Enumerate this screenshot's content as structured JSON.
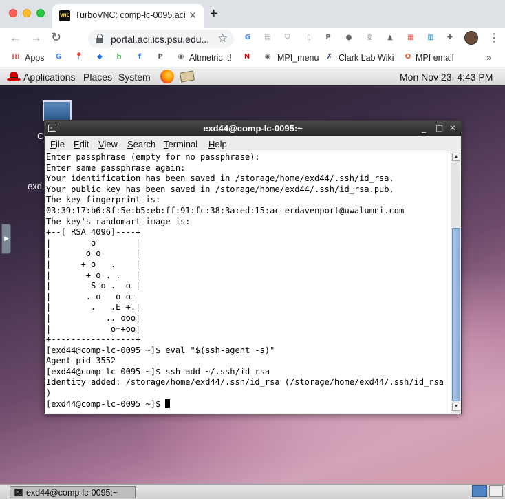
{
  "browser": {
    "tab_title": "TurboVNC: comp-lc-0095.aci",
    "tab_favicon_text": "VNC",
    "new_tab_symbol": "+",
    "close_symbol": "✕",
    "url": "portal.aci.ics.psu.edu...",
    "nav": {
      "back": "←",
      "forward": "→",
      "reload": "↻",
      "star": "☆",
      "menu": "⋮"
    },
    "extensions": [
      {
        "name": "translate-icon",
        "glyph": "G",
        "color": "#4285f4"
      },
      {
        "name": "reader-icon",
        "glyph": "▤",
        "color": "#9aa0a6"
      },
      {
        "name": "shield-icon",
        "glyph": "⛉",
        "color": "#9aa0a6"
      },
      {
        "name": "document-icon",
        "glyph": "▯",
        "color": "#9aa0a6"
      },
      {
        "name": "p-icon",
        "glyph": "P",
        "color": "#5f6368"
      },
      {
        "name": "circle-icon",
        "glyph": "●",
        "color": "#5f6368"
      },
      {
        "name": "chrome-icon",
        "glyph": "◎",
        "color": "#5f6368"
      },
      {
        "name": "drive-icon",
        "glyph": "▲",
        "color": "#5f6368"
      },
      {
        "name": "grid-icon",
        "glyph": "▦",
        "color": "#e8453c"
      },
      {
        "name": "trello-icon",
        "glyph": "▥",
        "color": "#0079bf"
      },
      {
        "name": "puzzle-icon",
        "glyph": "✚",
        "color": "#5f6368"
      }
    ]
  },
  "bookmarks": {
    "items": [
      {
        "label": "Apps",
        "icon": "apps-grid-icon",
        "glyph": "⁞⁞⁞",
        "color": "#e8453c"
      },
      {
        "label": "",
        "icon": "google-icon",
        "glyph": "G",
        "color": "#4285f4"
      },
      {
        "label": "",
        "icon": "maps-icon",
        "glyph": "📍",
        "color": "#34a853"
      },
      {
        "label": "",
        "icon": "diamond-icon",
        "glyph": "◆",
        "color": "#1a73e8"
      },
      {
        "label": "",
        "icon": "h-icon",
        "glyph": "h",
        "color": "#4caf50"
      },
      {
        "label": "",
        "icon": "facebook-icon",
        "glyph": "f",
        "color": "#1877f2"
      },
      {
        "label": "",
        "icon": "p-bookmark-icon",
        "glyph": "P",
        "color": "#5f6368"
      },
      {
        "label": "Altmetric it!",
        "icon": "globe-icon",
        "glyph": "◉",
        "color": "#5f6368"
      },
      {
        "label": "",
        "icon": "netflix-icon",
        "glyph": "N",
        "color": "#e50914"
      },
      {
        "label": "MPI_menu",
        "icon": "globe-icon",
        "glyph": "◉",
        "color": "#5f6368"
      },
      {
        "label": "Clark Lab Wiki",
        "icon": "wiki-icon",
        "glyph": "✗",
        "color": "#1b2f6e"
      },
      {
        "label": "MPI email",
        "icon": "mail-icon",
        "glyph": "O",
        "color": "#d65b2a"
      }
    ],
    "more": "»"
  },
  "gnome_panel": {
    "menus": [
      "Applications",
      "Places",
      "System"
    ],
    "clock": "Mon Nov 23,  4:43 PM"
  },
  "desktop": {
    "icon_label_partial": "C",
    "home_label_partial": "exd"
  },
  "terminal": {
    "title": "exd44@comp-lc-0095:~",
    "wm_buttons": [
      "_",
      "□",
      "✕"
    ],
    "menus": [
      {
        "first": "F",
        "rest": "ile"
      },
      {
        "first": "E",
        "rest": "dit"
      },
      {
        "first": "V",
        "rest": "iew"
      },
      {
        "first": "S",
        "rest": "earch"
      },
      {
        "first": "T",
        "rest": "erminal"
      },
      {
        "first": "H",
        "rest": "elp"
      }
    ],
    "lines": [
      "Enter passphrase (empty for no passphrase):",
      "Enter same passphrase again:",
      "Your identification has been saved in /storage/home/exd44/.ssh/id_rsa.",
      "Your public key has been saved in /storage/home/exd44/.ssh/id_rsa.pub.",
      "The key fingerprint is:",
      "03:39:17:b6:8f:5e:b5:eb:ff:91:fc:38:3a:ed:15:ac erdavenport@uwalumni.com",
      "The key's randomart image is:",
      "+--[ RSA 4096]----+",
      "|        o        |",
      "|       o o       |",
      "|      + o   .    |",
      "|       + o . .   |",
      "|        S o .  o |",
      "|       . o   o o|",
      "|        .   .E +.|",
      "|           .. ooo|",
      "|            o=+oo|",
      "+-----------------+",
      "[exd44@comp-lc-0095 ~]$ eval \"$(ssh-agent -s)\"",
      "Agent pid 3552",
      "[exd44@comp-lc-0095 ~]$ ssh-add ~/.ssh/id_rsa",
      "Identity added: /storage/home/exd44/.ssh/id_rsa (/storage/home/exd44/.ssh/id_rsa",
      ")"
    ],
    "prompt": "[exd44@comp-lc-0095 ~]$ ",
    "scroll_up": "▲",
    "scroll_down": "▼"
  },
  "taskbar": {
    "task_label": "exd44@comp-lc-0095:~",
    "task_icon_text": ">_"
  }
}
